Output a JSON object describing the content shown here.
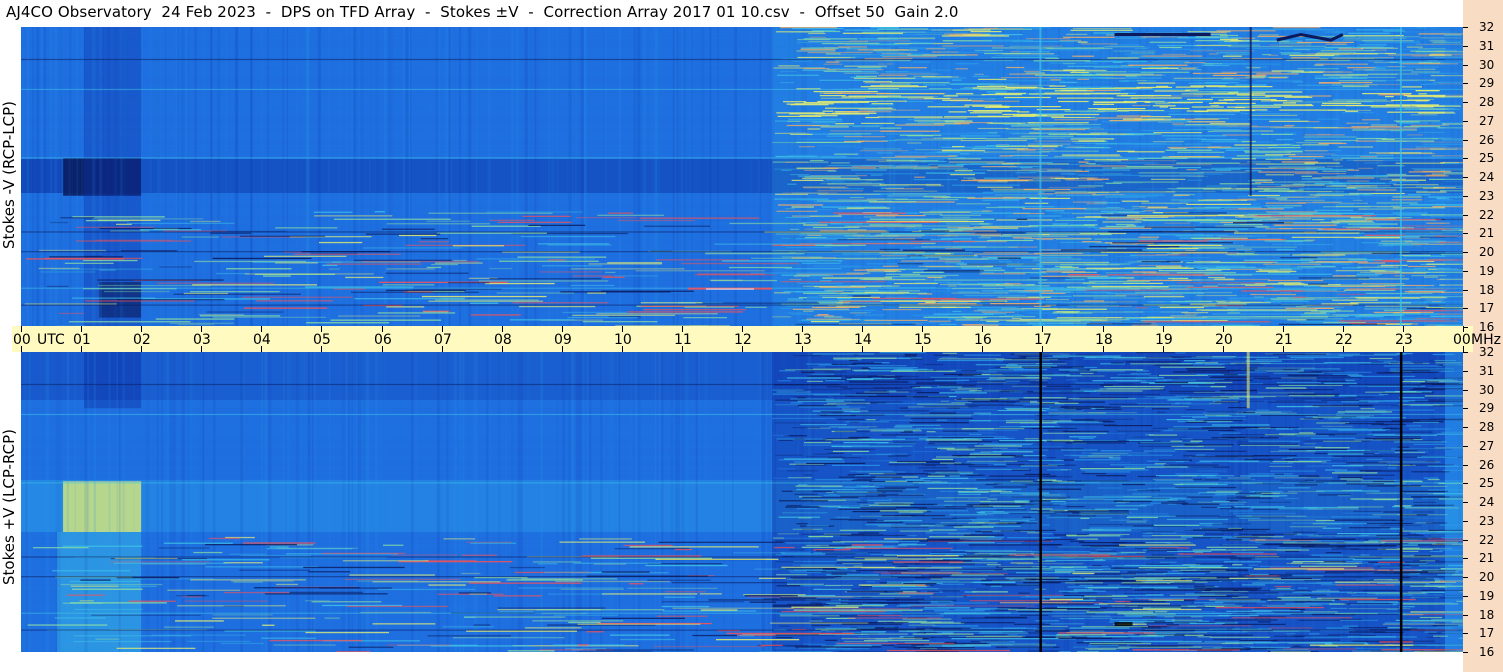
{
  "header": {
    "title": "AJ4CO Observatory  24 Feb 2023  -  DPS on TFD Array  -  Stokes ±V  -  Correction Array 2017 01 10.csv  -  Offset 50  Gain 2.0"
  },
  "chart_data": [
    {
      "type": "heatmap",
      "panel": "top",
      "ylabel": "Stokes -V (RCP-LCP)",
      "x_unit": "UTC",
      "y_unit": "MHz",
      "xlim": [
        0,
        24
      ],
      "ylim": [
        16,
        32
      ],
      "x_tick_labels": [
        "00",
        "01",
        "02",
        "03",
        "04",
        "05",
        "06",
        "07",
        "08",
        "09",
        "10",
        "11",
        "12",
        "13",
        "14",
        "15",
        "16",
        "17",
        "18",
        "19",
        "20",
        "21",
        "22",
        "23",
        "00"
      ],
      "y_tick_labels": [
        "32",
        "31",
        "30",
        "29",
        "28",
        "27",
        "26",
        "25",
        "24",
        "23",
        "22",
        "21",
        "20",
        "19",
        "18",
        "17",
        "16"
      ],
      "colormap": [
        "#0a1a5c",
        "#0d34a8",
        "#1f6fe0",
        "#2a9ce8",
        "#3fc4e6",
        "#8fe0a0",
        "#e8f070",
        "#ffb060",
        "#ff5050",
        "#ffffff"
      ]
    },
    {
      "type": "heatmap",
      "panel": "bottom",
      "ylabel": "Stokes +V  (LCP-RCP)",
      "x_unit": "UTC",
      "y_unit": "MHz",
      "xlim": [
        0,
        24
      ],
      "ylim": [
        16,
        32
      ],
      "x_tick_labels": [
        "00",
        "01",
        "02",
        "03",
        "04",
        "05",
        "06",
        "07",
        "08",
        "09",
        "10",
        "11",
        "12",
        "13",
        "14",
        "15",
        "16",
        "17",
        "18",
        "19",
        "20",
        "21",
        "22",
        "23",
        "00"
      ],
      "y_tick_labels": [
        "32",
        "31",
        "30",
        "29",
        "28",
        "27",
        "26",
        "25",
        "24",
        "23",
        "22",
        "21",
        "20",
        "19",
        "18",
        "17",
        "16"
      ],
      "colormap": [
        "#0a1a5c",
        "#0d34a8",
        "#1f6fe0",
        "#2a9ce8",
        "#3fc4e6",
        "#8fe0a0",
        "#e8f070",
        "#ffb060",
        "#ff5050",
        "#ffffff"
      ]
    }
  ]
}
